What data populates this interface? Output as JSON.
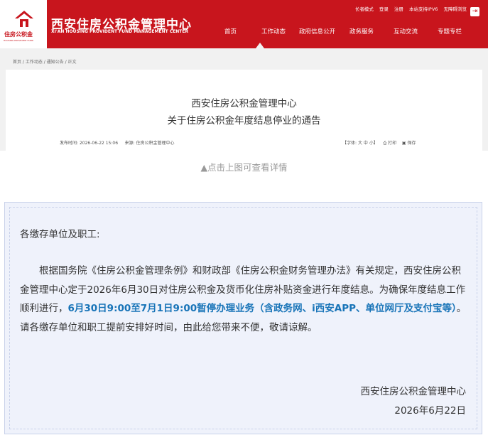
{
  "header": {
    "logo_text_cn": "住房公积金",
    "logo_text_en": "HOUSING PROVIDENT FUND",
    "site_title": "西安住房公积金管理中心",
    "site_subtitle": "XI'AN HOUSING PROVIDENT FUND MANAGEMENT CENTER",
    "topbar": {
      "elder_mode": "长者模式",
      "login": "登录",
      "register": "注册",
      "ipv6": "本站支持IPV6",
      "accessible": "无障碍浏览"
    },
    "exit_icon": "exit-icon",
    "nav": [
      "首页",
      "工作动态",
      "政府信息公开",
      "政务服务",
      "互动交流",
      "专题专栏"
    ],
    "active_nav": "工作动态",
    "brand_color": "#c8151d"
  },
  "breadcrumb": "首页 / 工作动态 / 通知公告 / 正文",
  "article": {
    "title_line1": "西安住房公积金管理中心",
    "title_line2": "关于住房公积金年度结息停业的通告",
    "publish_label": "发布时间:",
    "publish_time": "2026-06-22 15:06",
    "source_label": "来源:",
    "source": "住房公积金管理中心",
    "font_label": "【字体:",
    "font_large": "大",
    "font_medium": "中",
    "font_small": "小】",
    "print_label": "打印",
    "save_label": "保存"
  },
  "caption": "▲点击上图可查看详情",
  "notice": {
    "greeting": "各缴存单位及职工:",
    "para_part1": "根据国务院《住房公积金管理条例》和财政部《住房公积金财务管理办法》有关规定，西安住房公积金管理中心定于2026年6月30日对住房公积金及货币化住房补贴资金进行年度结息。为确保年度结息工作顺利进行，",
    "para_highlight": "6月30日9:00至7月1日9:00暂停办理业务（含政务网、i西安APP、单位网厅及支付宝等）",
    "para_part2": "。请各缴存单位和职工提前安排好时间，由此给您带来不便，敬请谅解。",
    "signature_org": "西安住房公积金管理中心",
    "signature_date": "2026年6月22日",
    "highlight_color": "#1874b8",
    "background_color": "#eff2fb"
  }
}
